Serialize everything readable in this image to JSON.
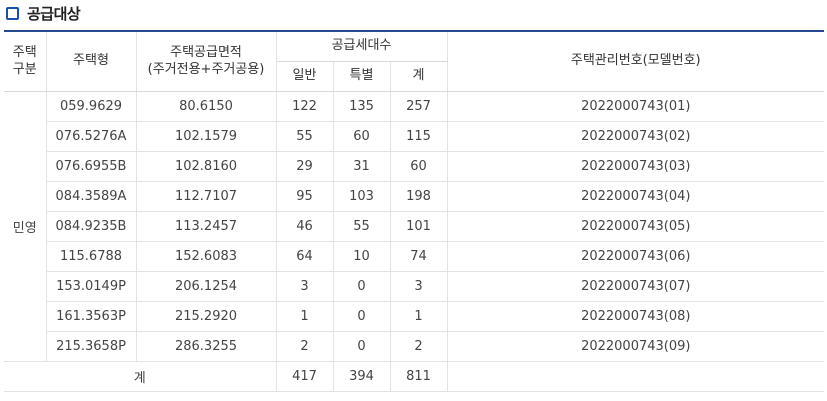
{
  "section": {
    "title": "공급대상",
    "accent_color": "#1a4fb0",
    "icon": "square-bullet-icon"
  },
  "headers": {
    "type_group": "주택\n구분",
    "house_type": "주택형",
    "area": "주택공급면적",
    "area_sub": "(주거전용+주거공용)",
    "units": "공급세대수",
    "general": "일반",
    "special": "특별",
    "total": "계",
    "mgmt_no": "주택관리번호(모델번호)"
  },
  "group_label": "민영",
  "rows": [
    {
      "type": "059.9629",
      "area": "80.6150",
      "general": "122",
      "special": "135",
      "total": "257",
      "mgmt": "2022000743(01)"
    },
    {
      "type": "076.5276A",
      "area": "102.1579",
      "general": "55",
      "special": "60",
      "total": "115",
      "mgmt": "2022000743(02)"
    },
    {
      "type": "076.6955B",
      "area": "102.8160",
      "general": "29",
      "special": "31",
      "total": "60",
      "mgmt": "2022000743(03)"
    },
    {
      "type": "084.3589A",
      "area": "112.7107",
      "general": "95",
      "special": "103",
      "total": "198",
      "mgmt": "2022000743(04)"
    },
    {
      "type": "084.9235B",
      "area": "113.2457",
      "general": "46",
      "special": "55",
      "total": "101",
      "mgmt": "2022000743(05)"
    },
    {
      "type": "115.6788",
      "area": "152.6083",
      "general": "64",
      "special": "10",
      "total": "74",
      "mgmt": "2022000743(06)"
    },
    {
      "type": "153.0149P",
      "area": "206.1254",
      "general": "3",
      "special": "0",
      "total": "3",
      "mgmt": "2022000743(07)"
    },
    {
      "type": "161.3563P",
      "area": "215.2920",
      "general": "1",
      "special": "0",
      "total": "1",
      "mgmt": "2022000743(08)"
    },
    {
      "type": "215.3658P",
      "area": "286.3255",
      "general": "2",
      "special": "0",
      "total": "2",
      "mgmt": "2022000743(09)"
    }
  ],
  "summary": {
    "label": "계",
    "general": "417",
    "special": "394",
    "total": "811"
  }
}
